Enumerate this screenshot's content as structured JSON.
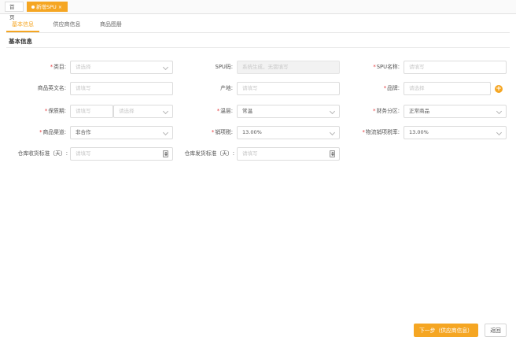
{
  "page_tabs": {
    "home": "首页",
    "active": "新增SPU",
    "close": "×"
  },
  "tabs": [
    "基本信息",
    "供应商信息",
    "商品图册"
  ],
  "section_title": "基本信息",
  "labels": {
    "category": "类目:",
    "spu_code": "SPU码:",
    "spu_name": "SPU名称:",
    "english_name": "商品英文名:",
    "origin": "产地:",
    "brand": "品牌:",
    "shelf_life": "保质期:",
    "temp_zone": "温层:",
    "finance_zone": "财务分区:",
    "channel": "商品渠道:",
    "sales_tax": "销项税:",
    "logistics_tax": "物流销项税率:",
    "warehouse_receive": "仓库收货标准（天）:",
    "warehouse_ship": "仓库发货标准（天）:"
  },
  "required_mark": "*",
  "fields": {
    "category": "请选择",
    "spu_code": "系统生成，无需填写",
    "spu_name": "请填写",
    "english_name": "请填写",
    "origin": "请填写",
    "brand": "请选择",
    "shelf_life_value": "请填写",
    "shelf_life_unit": "请选择",
    "temp_zone": "常温",
    "finance_zone": "正常商品",
    "channel": "非合作",
    "sales_tax": "13.00%",
    "logistics_tax": "13.00%",
    "warehouse_receive": "请填写",
    "warehouse_ship": "请填写"
  },
  "add_icon": "+",
  "buttons": {
    "next": "下一步（供应商信息）",
    "back": "返回"
  },
  "colors": {
    "accent": "#f5a623",
    "required": "#e4393c"
  }
}
